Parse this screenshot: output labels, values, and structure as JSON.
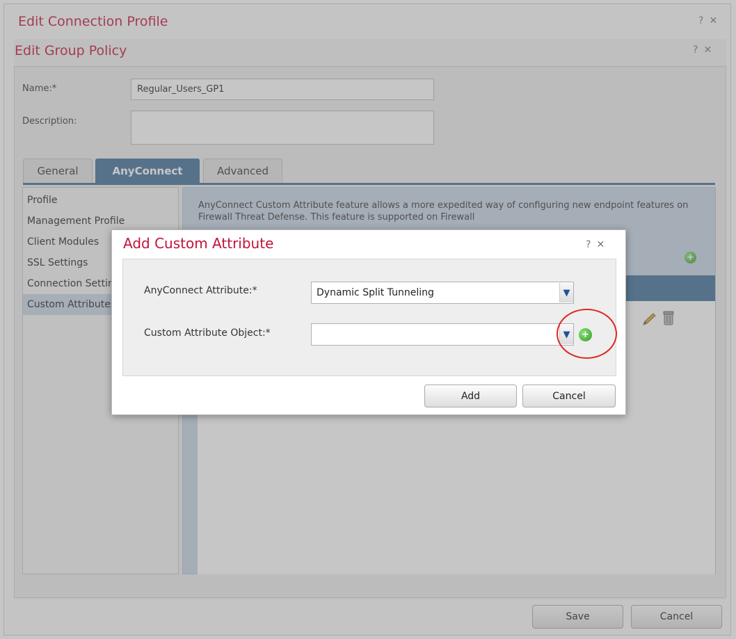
{
  "outer_window": {
    "title": "Edit Connection Profile",
    "help_icon": "?",
    "close_icon": "✕"
  },
  "group_policy": {
    "title": "Edit Group Policy",
    "help_icon": "?",
    "close_icon": "✕",
    "name_label": "Name:*",
    "name_value": "Regular_Users_GP1",
    "description_label": "Description:",
    "description_value": "",
    "tabs": [
      {
        "label": "General",
        "active": false
      },
      {
        "label": "AnyConnect",
        "active": true
      },
      {
        "label": "Advanced",
        "active": false
      }
    ],
    "nav_items": [
      {
        "label": "Profile",
        "selected": false
      },
      {
        "label": "Management Profile",
        "selected": false
      },
      {
        "label": "Client Modules",
        "selected": false
      },
      {
        "label": "SSL Settings",
        "selected": false
      },
      {
        "label": "Connection Settings",
        "selected": false
      },
      {
        "label": "Custom Attributes",
        "selected": true
      }
    ],
    "description_text": "AnyConnect Custom Attribute feature allows a more expedited way of configuring new endpoint features on Firewall Threat Defense. This feature is supported on Firewall",
    "save_button": "Save",
    "cancel_button": "Cancel"
  },
  "dialog": {
    "title": "Add Custom Attribute",
    "help_icon": "?",
    "close_icon": "✕",
    "attribute_label": "AnyConnect Attribute:*",
    "attribute_value": "Dynamic Split Tunneling",
    "object_label": "Custom Attribute Object:*",
    "object_value": "",
    "add_button": "Add",
    "cancel_button": "Cancel"
  },
  "colors": {
    "title_red": "#c3123a",
    "tab_blue": "#3f6e9a",
    "highlight_red": "#e0261f",
    "add_green": "#2f9a22"
  }
}
